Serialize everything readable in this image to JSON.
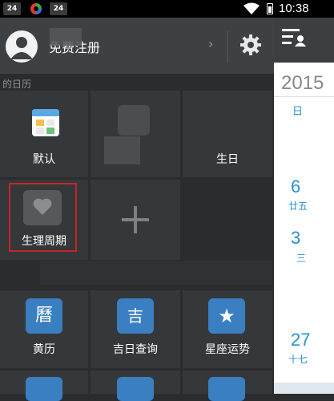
{
  "status_bar": {
    "icons": [
      "24",
      "app-icon",
      "24"
    ],
    "time": "10:38"
  },
  "header": {
    "name": "免费注册",
    "chevron": "›"
  },
  "sections": {
    "my_calendars": "的日历",
    "tools": ""
  },
  "calendars": [
    {
      "label": "默认",
      "icon": "calendar-icon"
    },
    {
      "label": "",
      "icon": "clock-icon"
    },
    {
      "label": "生日",
      "icon": "birthday-icon"
    },
    {
      "label": "生理周期",
      "icon": "heart-icon"
    },
    {
      "label": "",
      "icon": "add-icon"
    }
  ],
  "tools": [
    {
      "label": "黄历",
      "glyph": "曆"
    },
    {
      "label": "吉日查询",
      "glyph": "吉"
    },
    {
      "label": "星座运势",
      "glyph": "★"
    }
  ],
  "right_panel": {
    "year": "2015",
    "weekday": "日",
    "dates": [
      {
        "day": "6",
        "lunar": "廿五"
      },
      {
        "day": "3",
        "lunar": "三"
      },
      {
        "day": "27",
        "lunar": "十七"
      }
    ]
  },
  "colors": {
    "highlight": "#c8232b",
    "accent_blue": "#2a8fd4",
    "tile_blue": "#3a7fc1"
  }
}
